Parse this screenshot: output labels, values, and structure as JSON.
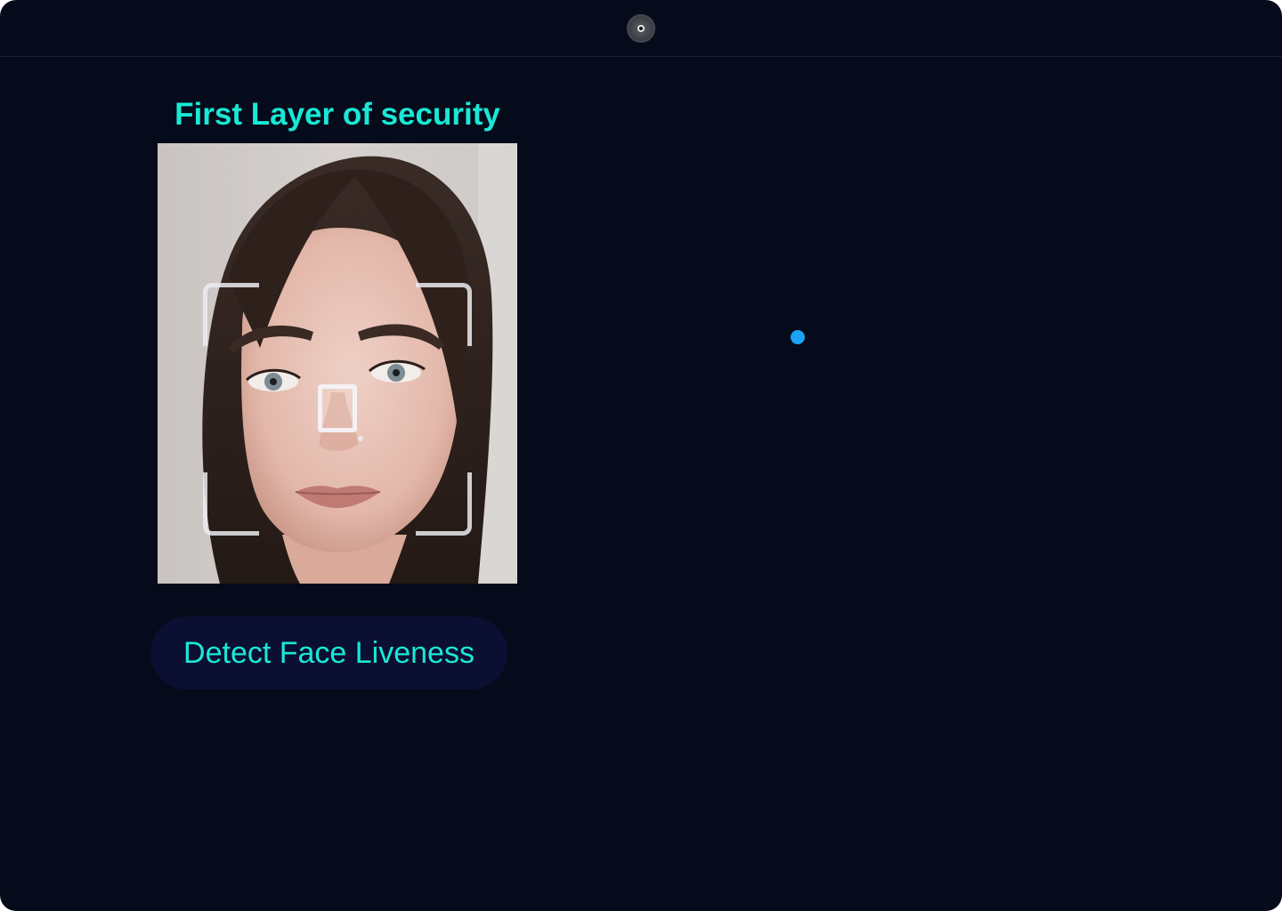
{
  "header": {
    "camera_icon": "webcam-icon"
  },
  "main": {
    "title": "First Layer of security",
    "face_preview": {
      "icon_frame": "face-scan-frame-icon",
      "icon_target": "nose-target-icon"
    },
    "detect_button_label": "Detect Face Liveness"
  },
  "colors": {
    "background": "#050b1a",
    "accent": "#19e8d6",
    "button_bg": "#0b0f32",
    "cursor": "#1aa3f5"
  }
}
